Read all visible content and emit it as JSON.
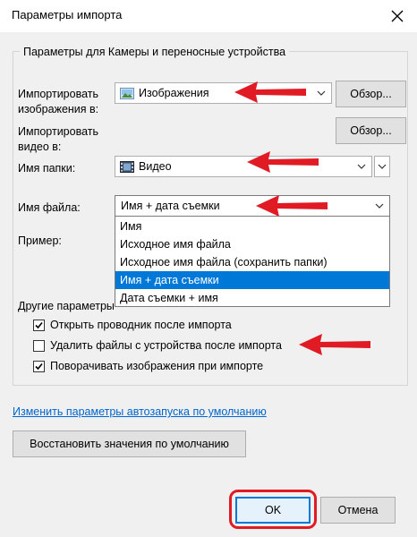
{
  "window": {
    "title": "Параметры импорта"
  },
  "group": {
    "legend": "Параметры для Камеры и переносные устройства"
  },
  "images_dest": {
    "label_line1": "Импортировать",
    "label_line2": "изображения в:",
    "value": "Изображения",
    "browse": "Обзор..."
  },
  "video_dest": {
    "label_line1": "Импортировать",
    "label_line2": "видео в:",
    "browse": "Обзор..."
  },
  "folder": {
    "label": "Имя папки:",
    "value": "Видео"
  },
  "file": {
    "label": "Имя файла:",
    "value": "Имя + дата съемки",
    "options": [
      "Имя",
      "Исходное имя файла",
      "Исходное имя файла (сохранить папки)",
      "Имя + дата съемки",
      "Дата съемки + имя"
    ],
    "selected_index": 3
  },
  "example": {
    "label": "Пример:"
  },
  "other": {
    "label": "Другие параметры"
  },
  "checks": [
    {
      "label": "Открыть проводник после импорта",
      "checked": true
    },
    {
      "label": "Удалить файлы с устройства после импорта",
      "checked": false
    },
    {
      "label": "Поворачивать изображения при импорте",
      "checked": true
    }
  ],
  "links": {
    "autoplay": "Изменить параметры автозапуска по умолчанию"
  },
  "buttons": {
    "restore": "Восстановить значения по умолчанию",
    "ok": "OK",
    "cancel": "Отмена"
  },
  "colors": {
    "annotation_arrow": "#e01b24",
    "selection": "#0078d7",
    "link": "#0066cc"
  }
}
